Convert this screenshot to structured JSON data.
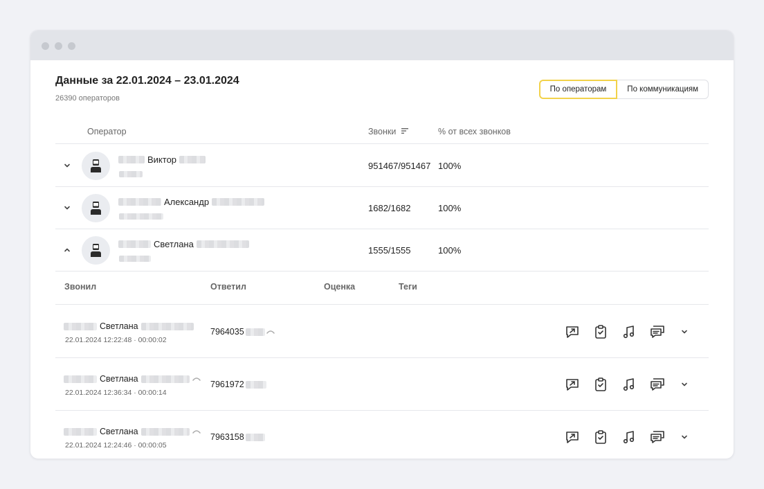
{
  "window": {
    "dots": 3
  },
  "header": {
    "title": "Данные за 22.01.2024 – 23.01.2024",
    "subtitle": "26390 операторов"
  },
  "segmented": {
    "by_operators": "По операторам",
    "by_communications": "По коммуникациям",
    "selected": "По операторам"
  },
  "table": {
    "columns": {
      "operator": "Оператор",
      "calls": "Звонки",
      "percent": "% от всех звонков"
    },
    "rows": [
      {
        "name": "Виктор",
        "calls": "951467/951467",
        "percent": "100%",
        "expanded": false
      },
      {
        "name": "Александр",
        "calls": "1682/1682",
        "percent": "100%",
        "expanded": false
      },
      {
        "name": "Светлана",
        "calls": "1555/1555",
        "percent": "100%",
        "expanded": true
      }
    ]
  },
  "details": {
    "columns": {
      "caller": "Звонил",
      "answered": "Ответил",
      "rating": "Оценка",
      "tags": "Теги"
    },
    "calls": [
      {
        "caller": "Светлана",
        "meta": "22.01.2024 12:22:48 · 00:00:02",
        "answered": "7964035"
      },
      {
        "caller": "Светлана",
        "meta": "22.01.2024 12:36:34 · 00:00:14",
        "answered": "7961972"
      },
      {
        "caller": "Светлана",
        "meta": "22.01.2024 12:24:46 · 00:00:05",
        "answered": "7963158"
      }
    ]
  },
  "icons": {
    "actions": [
      "share-chat-icon",
      "clipboard-check-icon",
      "music-note-icon",
      "chat-bubbles-icon"
    ],
    "expand": "chevron-down-icon"
  },
  "colors": {
    "accent_selected_border": "#f2d24a",
    "background": "#f1f2f6",
    "titlebar": "#e2e4e9"
  }
}
